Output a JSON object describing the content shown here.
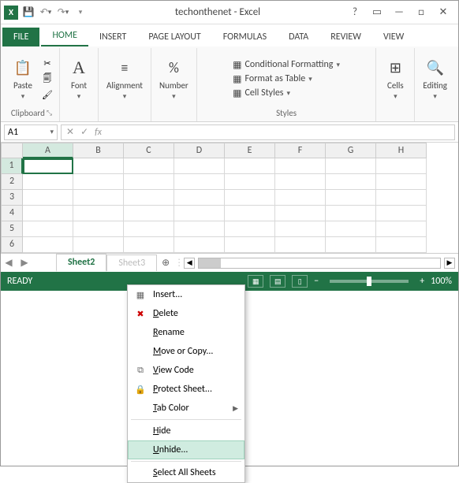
{
  "titlebar": {
    "title": "techonthenet - Excel"
  },
  "tabs": {
    "file": "FILE",
    "home": "HOME",
    "insert": "INSERT",
    "page_layout": "PAGE LAYOUT",
    "formulas": "FORMULAS",
    "data": "DATA",
    "review": "REVIEW",
    "view": "VIEW"
  },
  "ribbon": {
    "clipboard": {
      "paste": "Paste",
      "label": "Clipboard"
    },
    "font": {
      "btn": "Font"
    },
    "alignment": {
      "btn": "Alignment"
    },
    "number": {
      "btn": "Number",
      "percent": "%"
    },
    "styles": {
      "cond": "Conditional Formatting",
      "table": "Format as Table",
      "cell": "Cell Styles",
      "label": "Styles"
    },
    "cells": {
      "btn": "Cells"
    },
    "editing": {
      "btn": "Editing"
    }
  },
  "namebox": "A1",
  "columns": [
    "A",
    "B",
    "C",
    "D",
    "E",
    "F",
    "G",
    "H"
  ],
  "rows": [
    "1",
    "2",
    "3",
    "4",
    "5",
    "6"
  ],
  "sheets": {
    "active": "Sheet2",
    "next": "Sheet3"
  },
  "status": {
    "ready": "READY",
    "zoom": "100%"
  },
  "context": {
    "insert": "Insert...",
    "delete": "Delete",
    "rename": "Rename",
    "move": "Move or Copy...",
    "viewcode": "View Code",
    "protect": "Protect Sheet...",
    "tabcolor": "Tab Color",
    "hide": "Hide",
    "unhide": "Unhide...",
    "selectall": "Select All Sheets"
  }
}
